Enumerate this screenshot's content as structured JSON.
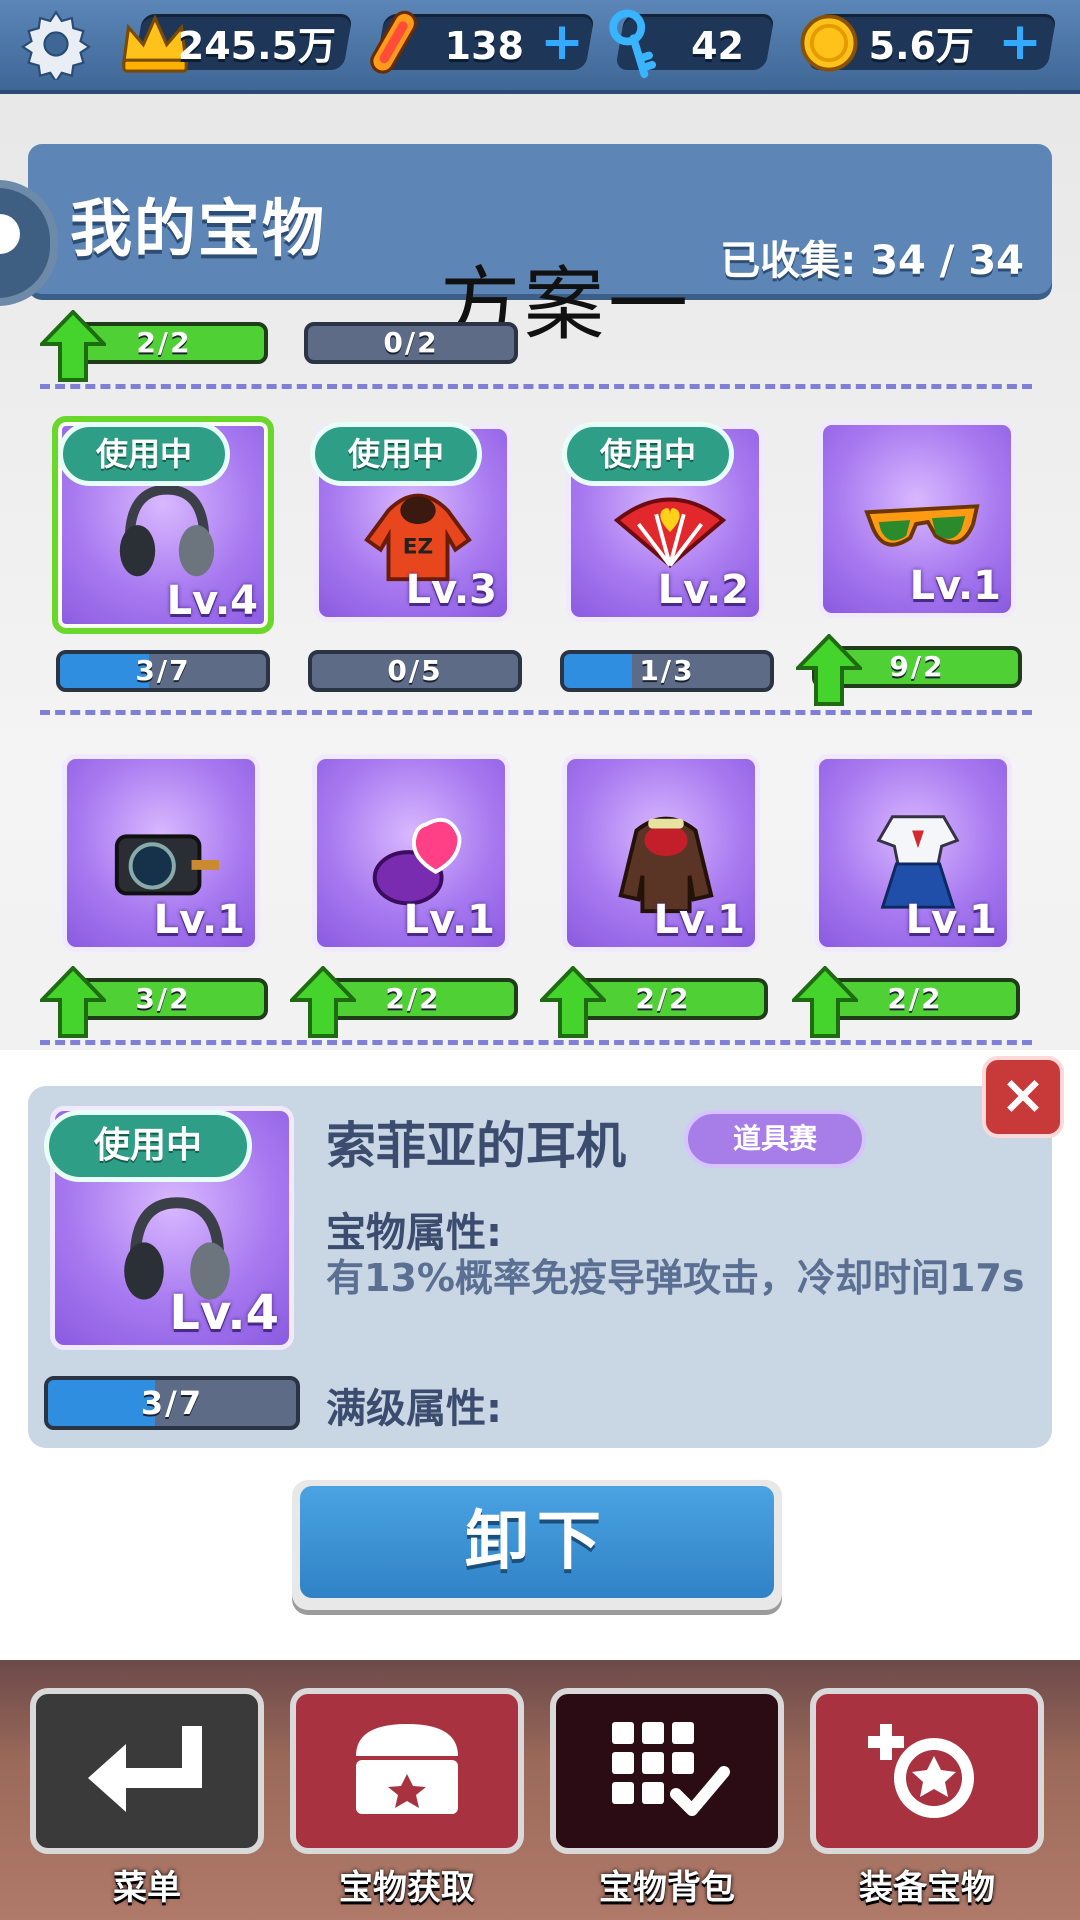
{
  "top_bar": {
    "crowns": "245.5万",
    "boards": "138",
    "keys": "42",
    "coins": "5.6万",
    "plus_symbol": "+"
  },
  "header": {
    "title": "我的宝物",
    "collected": "已收集: 34 / 34"
  },
  "overlay_label": "方案一",
  "row0": [
    {
      "progress": "2/2"
    },
    {
      "progress": "0/2"
    }
  ],
  "row1": [
    {
      "status": "使用中",
      "level": "Lv.4",
      "progress": "3/7",
      "progress_fraction": 0.43,
      "icon": "headphones-icon"
    },
    {
      "status": "使用中",
      "level": "Lv.3",
      "progress": "0/5",
      "progress_fraction": 0.0,
      "icon": "hoodie-icon"
    },
    {
      "status": "使用中",
      "level": "Lv.2",
      "progress": "1/3",
      "progress_fraction": 0.33,
      "icon": "fan-icon"
    },
    {
      "level": "Lv.1",
      "progress": "9/2",
      "icon": "sunglasses-icon"
    }
  ],
  "row2": [
    {
      "level": "Lv.1",
      "progress": "3/2",
      "icon": "camera-icon"
    },
    {
      "level": "Lv.1",
      "progress": "2/2",
      "icon": "gem-ring-icon"
    },
    {
      "level": "Lv.1",
      "progress": "2/2",
      "icon": "jacket-icon"
    },
    {
      "level": "Lv.1",
      "progress": "2/2",
      "icon": "sailor-uniform-icon"
    }
  ],
  "detail": {
    "status": "使用中",
    "level": "Lv.4",
    "progress": "3/7",
    "progress_fraction": 0.43,
    "name": "索菲亚的耳机",
    "tag": "道具赛",
    "attr_heading": "宝物属性:",
    "attr_text": "有13%概率免疫导弹攻击，冷却时间17s",
    "max_heading": "满级属性:",
    "close_symbol": "×"
  },
  "action_button": "卸下",
  "nav": [
    "菜单",
    "宝物获取",
    "宝物背包",
    "装备宝物"
  ],
  "colors": {
    "accent_blue": "#2f82c6",
    "progress_green": "#4fd136",
    "card_purple": "#a87af0",
    "inuse_teal": "#2f9e86"
  }
}
